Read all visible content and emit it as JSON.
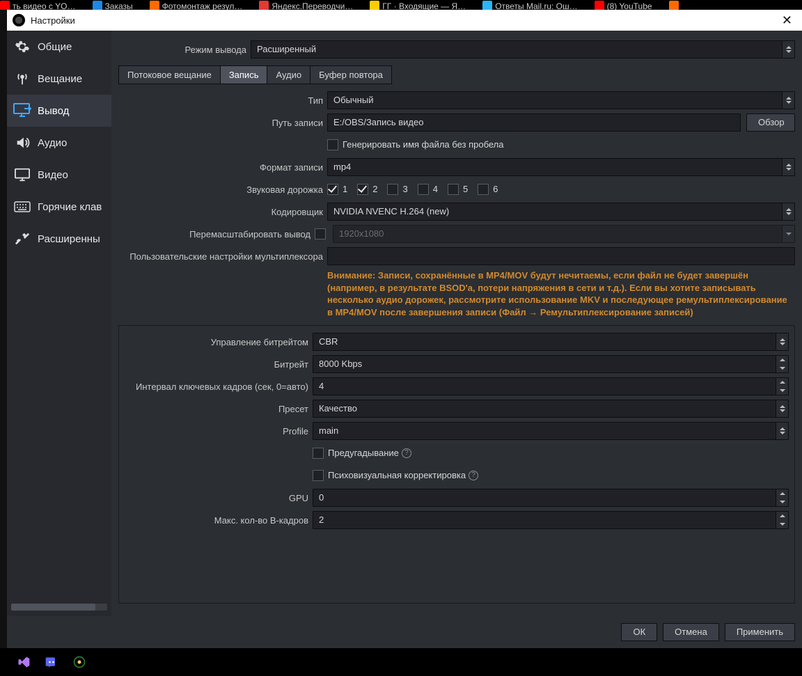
{
  "taskbar": {
    "items": [
      {
        "label": "ть видео с YO…",
        "color": "#ff0000"
      },
      {
        "label": "Заказы",
        "color": "#1e88e5"
      },
      {
        "label": "Фотомонтаж резул…",
        "color": "#ff6a00"
      },
      {
        "label": "Яндекс.Переводчи…",
        "color": "#e53935"
      },
      {
        "label": "ГГ · Входящие — Я…",
        "color": "#ffcc00"
      },
      {
        "label": "Ответы Mail.ru: Ош…",
        "color": "#29b6f6"
      },
      {
        "label": "(8) YouTube",
        "color": "#ff0000"
      },
      {
        "label": "",
        "color": "#ff6a00"
      }
    ]
  },
  "window": {
    "title": "Настройки"
  },
  "sidebar": {
    "items": [
      {
        "label": "Общие"
      },
      {
        "label": "Вещание"
      },
      {
        "label": "Вывод"
      },
      {
        "label": "Аудио"
      },
      {
        "label": "Видео"
      },
      {
        "label": "Горячие клав"
      },
      {
        "label": "Расширенны"
      }
    ]
  },
  "top": {
    "mode_label": "Режим вывода",
    "mode_value": "Расширенный"
  },
  "tabs": [
    "Потоковое вещание",
    "Запись",
    "Аудио",
    "Буфер повтора"
  ],
  "rec": {
    "type_label": "Тип",
    "type_value": "Обычный",
    "path_label": "Путь записи",
    "path_value": "E:/OBS/Запись видео",
    "browse": "Обзор",
    "nospace_label": "Генерировать имя файла без пробела",
    "format_label": "Формат записи",
    "format_value": "mp4",
    "track_label": "Звуковая дорожка",
    "tracks": [
      "1",
      "2",
      "3",
      "4",
      "5",
      "6"
    ],
    "encoder_label": "Кодировщик",
    "encoder_value": "NVIDIA NVENC H.264 (new)",
    "rescale_label": "Перемасштабировать вывод",
    "rescale_value": "1920x1080",
    "mux_label": "Пользовательские настройки мультиплексора",
    "warning": "Внимание: Записи, сохранённые в MP4/MOV будут нечитаемы, если файл не будет завершён (например, в результате BSOD'a, потери напряжения в сети и т.д.). Если вы хотите записывать несколько аудио дорожек, рассмотрите использование MKV и последующее ремультиплексирование в MP4/MOV после завершения записи (Файл → Ремультиплексирование записей)"
  },
  "enc": {
    "rate_label": "Управление битрейтом",
    "rate_value": "CBR",
    "bitrate_label": "Битрейт",
    "bitrate_value": "8000 Kbps",
    "keyint_label": "Интервал ключевых кадров (сек, 0=авто)",
    "keyint_value": "4",
    "preset_label": "Пресет",
    "preset_value": "Качество",
    "profile_label": "Profile",
    "profile_value": "main",
    "lookahead_label": "Предугадывание",
    "psycho_label": "Психовизуальная корректировка",
    "gpu_label": "GPU",
    "gpu_value": "0",
    "bframes_label": "Макс. кол-во B-кадров",
    "bframes_value": "2"
  },
  "footer": {
    "ok": "ОК",
    "cancel": "Отмена",
    "apply": "Применить"
  }
}
